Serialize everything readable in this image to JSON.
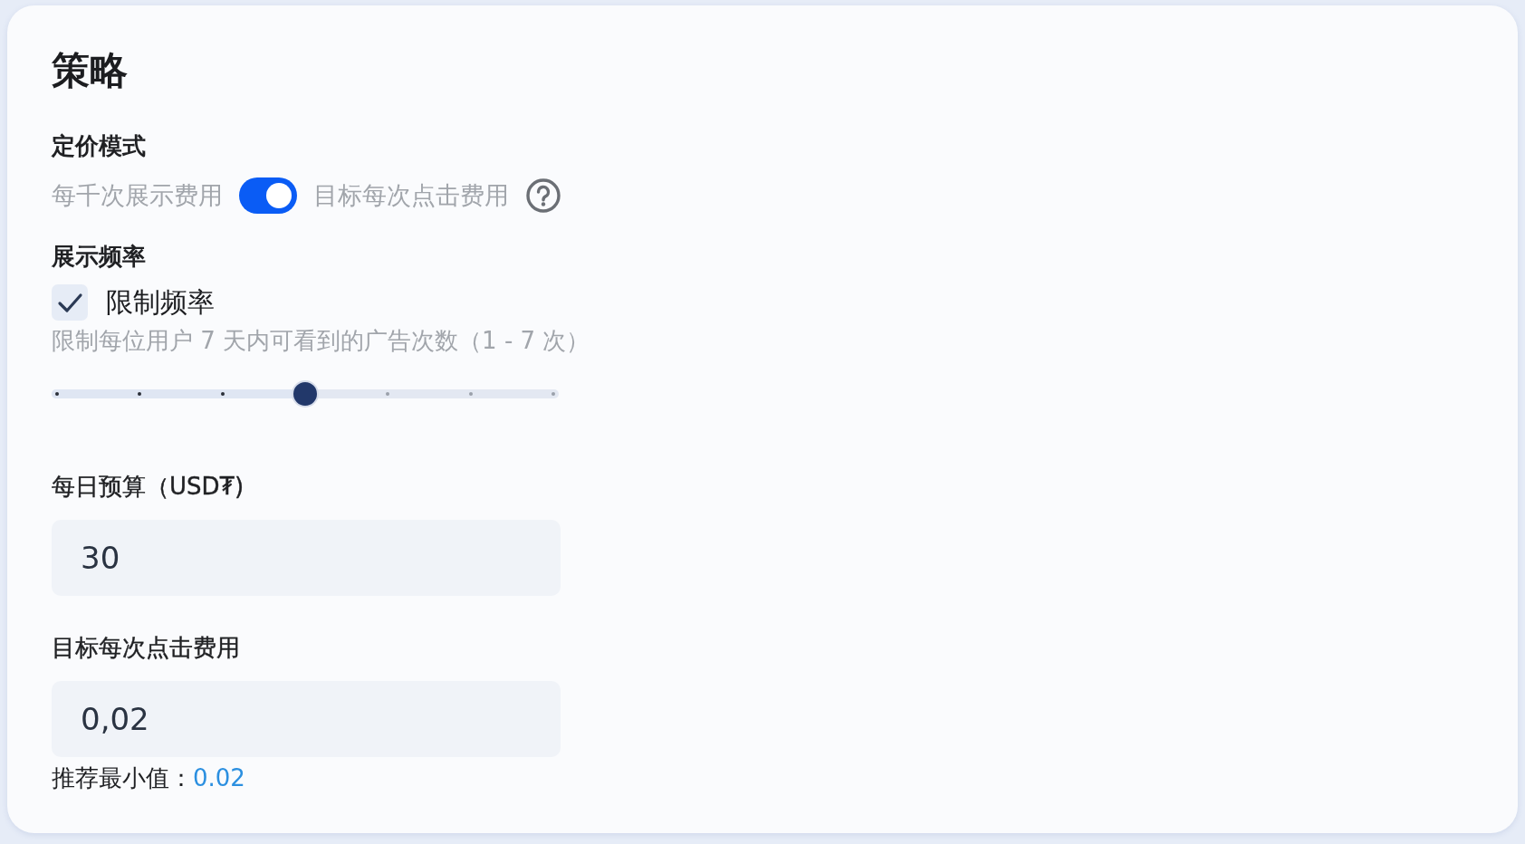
{
  "title": "策略",
  "pricing_mode": {
    "label": "定价模式",
    "left_option": "每千次展示费用",
    "right_option": "目标每次点击费用",
    "on": true
  },
  "frequency": {
    "label": "展示频率",
    "checkbox": {
      "label": "限制频率",
      "checked": true
    },
    "description": "限制每位用户 7 天内可看到的广告次数（1 - 7 次）",
    "slider": {
      "level": 0.5
    }
  },
  "daily_budget": {
    "label": "每日预算（USD₮)",
    "value": "30"
  },
  "target_cpc": {
    "label": "目标每次点击费用",
    "value": "0,02",
    "hint": "推荐最小值：",
    "hint_value": "0.02"
  }
}
